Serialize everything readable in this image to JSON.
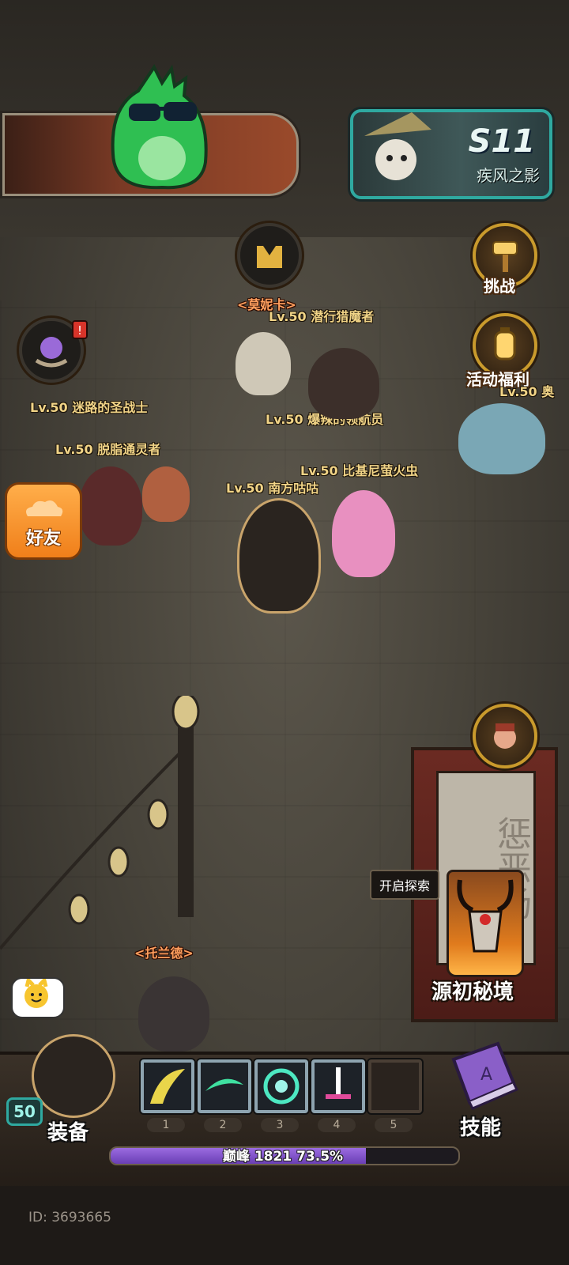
{
  "season": {
    "number": "S11",
    "name": "疾风之影"
  },
  "side_buttons": {
    "challenge": "挑战",
    "event_rewards": "活动福利",
    "friends": "好友"
  },
  "players": [
    {
      "label": "Lv.50 潜行猎魔者"
    },
    {
      "label": "Lv.50 迷路的圣战士"
    },
    {
      "label": "Lv.50 爆辣的领航员"
    },
    {
      "label": "Lv.50 脱脂通灵者"
    },
    {
      "label": "Lv.50 比基尼萤火虫"
    },
    {
      "label": "Lv.50 南方咕咕"
    },
    {
      "label": "Lv.50 奥"
    }
  ],
  "npcs": {
    "monica": "<莫妮卡>",
    "toland": "<托兰德>"
  },
  "banner_text": "惩恶扬",
  "map": {
    "tooltip": "开启探索",
    "dungeon_label": "源初秘境"
  },
  "bottom": {
    "equipment": "装备",
    "skills": "技能",
    "player_level": "50",
    "slot_numbers": [
      "1",
      "2",
      "3",
      "4",
      "5"
    ],
    "peak_label": "巅峰 1821",
    "progress_text": "73.5%",
    "progress_value": 73.5
  },
  "footer": {
    "id_text": "ID: 3693665"
  },
  "colors": {
    "accent_teal": "#2fa9a0",
    "accent_gold": "#c99a2c",
    "friend_orange": "#f07f1a",
    "xp_purple": "#7b4dc9"
  }
}
